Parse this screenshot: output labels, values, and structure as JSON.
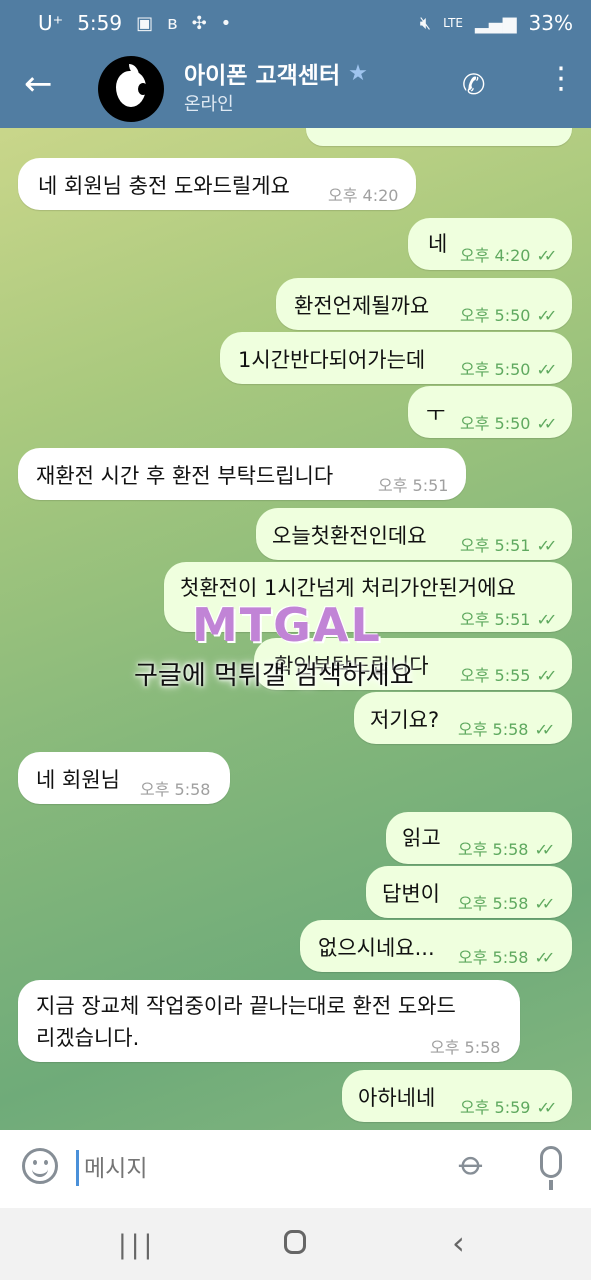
{
  "status_bar": {
    "carrier": "U⁺",
    "time": "5:59",
    "network": "LTE",
    "battery": "33%"
  },
  "header": {
    "title": "아이폰 고객센터",
    "status": "온라인",
    "icons": [
      "back-arrow-icon",
      "apple-logo-avatar",
      "star-icon",
      "phone-icon",
      "more-vertical-icon"
    ]
  },
  "messages": [
    {
      "dir": "in",
      "text": "네 회원님 충전 도와드릴게요",
      "time": "오후 4:20"
    },
    {
      "dir": "out",
      "text": "네",
      "time": "오후 4:20"
    },
    {
      "dir": "out",
      "text": "환전언제될까요",
      "time": "오후 5:50"
    },
    {
      "dir": "out",
      "text": "1시간반다되어가는데",
      "time": "오후 5:50"
    },
    {
      "dir": "out",
      "text": "ㅜ",
      "time": "오후 5:50"
    },
    {
      "dir": "in",
      "text": "재환전 시간 후 환전 부탁드립니다",
      "time": "오후 5:51"
    },
    {
      "dir": "out",
      "text": "오늘첫환전인데요",
      "time": "오후 5:51"
    },
    {
      "dir": "out",
      "text": "첫환전이 1시간넘게 처리가안된거에요",
      "time": "오후 5:51"
    },
    {
      "dir": "out",
      "text": "확인부탁드립니다",
      "time": "오후 5:55"
    },
    {
      "dir": "out",
      "text": "저기요?",
      "time": "오후 5:58"
    },
    {
      "dir": "in",
      "text": "네 회원님",
      "time": "오후 5:58"
    },
    {
      "dir": "out",
      "text": "읽고",
      "time": "오후 5:58"
    },
    {
      "dir": "out",
      "text": "답변이",
      "time": "오후 5:58"
    },
    {
      "dir": "out",
      "text": "없으시네요...",
      "time": "오후 5:58"
    },
    {
      "dir": "in",
      "text": "지금 장교체 작업중이라 끝나는대로 환전 도와드",
      "text2": "리겠습니다.",
      "time": "오후 5:58"
    },
    {
      "dir": "out",
      "text": "아하네네",
      "time": "오후 5:59"
    }
  ],
  "watermark": {
    "logo": "MTGAL",
    "caption": "구글에 먹튀갤 검색하세요"
  },
  "input": {
    "placeholder": "메시지"
  }
}
